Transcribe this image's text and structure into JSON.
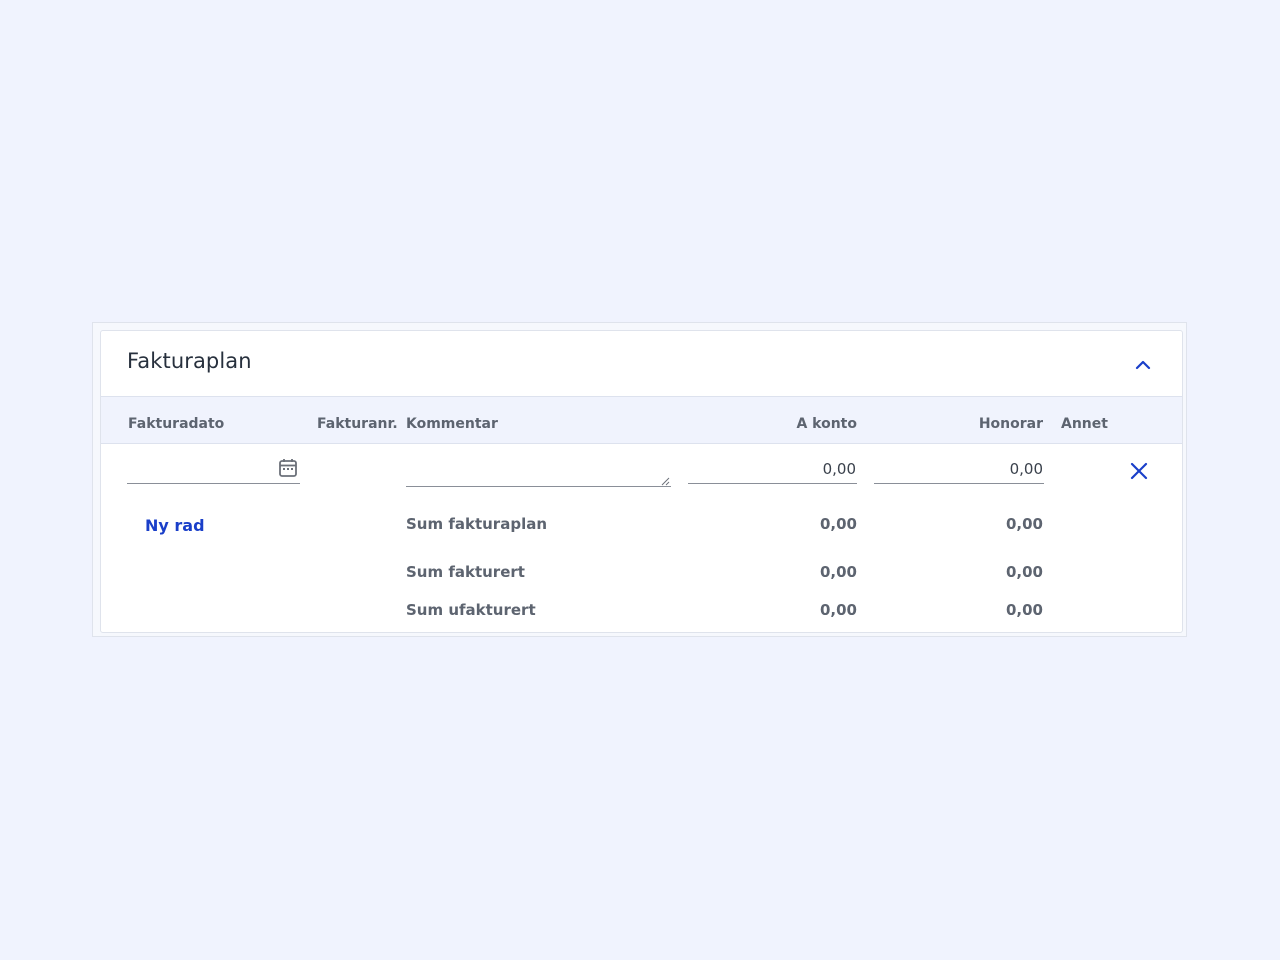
{
  "panel": {
    "title": "Fakturaplan"
  },
  "columns": {
    "fakturadato": "Fakturadato",
    "fakturanr": "Fakturanr.",
    "kommentar": "Kommentar",
    "a_konto": "A konto",
    "honorar": "Honorar",
    "annet": "Annet"
  },
  "row": {
    "fakturadato": "",
    "kommentar": "",
    "a_konto": "0,00",
    "honorar": "0,00"
  },
  "actions": {
    "new_row": "Ny rad"
  },
  "sums": {
    "fakturaplan": {
      "label": "Sum fakturaplan",
      "a_konto": "0,00",
      "honorar": "0,00"
    },
    "fakturert": {
      "label": "Sum fakturert",
      "a_konto": "0,00",
      "honorar": "0,00"
    },
    "ufakturert": {
      "label": "Sum ufakturert",
      "a_konto": "0,00",
      "honorar": "0,00"
    }
  },
  "icons": {
    "collapse": "chevron-up-icon",
    "calendar": "calendar-icon",
    "delete": "close-icon"
  },
  "colors": {
    "accent": "#1a3fc9",
    "background": "#f0f3fe"
  }
}
